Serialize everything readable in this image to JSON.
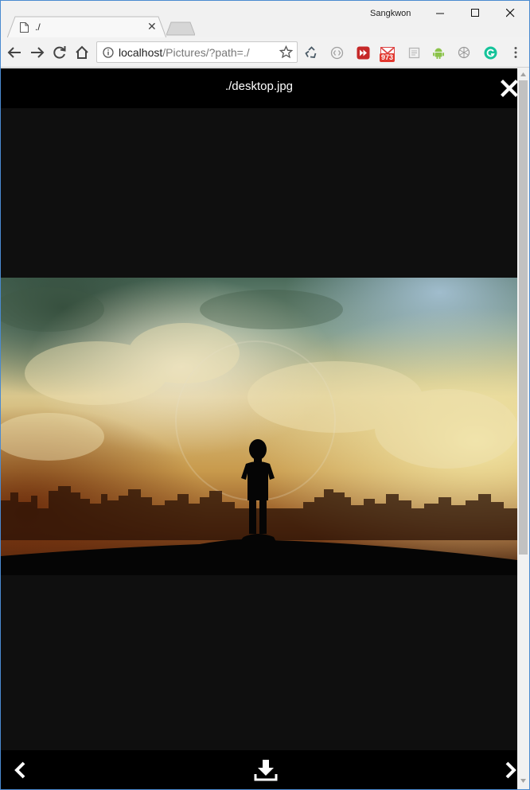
{
  "browser": {
    "profile_name": "Sangkwon",
    "tab": {
      "title": "./"
    },
    "url_host": "localhost",
    "url_path": "/Pictures/?path=./",
    "extension_badge": "973"
  },
  "viewer": {
    "title": "./desktop.jpg"
  },
  "icons": {
    "close": "close-icon",
    "prev": "chevron-left-icon",
    "next": "chevron-right-icon",
    "download": "download-icon"
  },
  "colors": {
    "viewer_bg": "#0f0f0f",
    "viewer_bar": "#000000",
    "window_border": "#4a8ad0"
  }
}
